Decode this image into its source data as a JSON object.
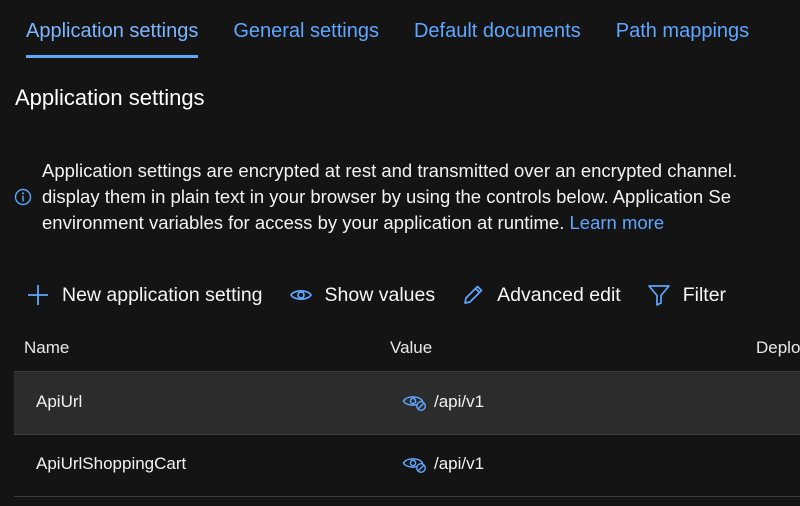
{
  "tabs": [
    {
      "label": "Application settings",
      "active": true
    },
    {
      "label": "General settings",
      "active": false
    },
    {
      "label": "Default documents",
      "active": false
    },
    {
      "label": "Path mappings",
      "active": false
    }
  ],
  "section": {
    "title": "Application settings"
  },
  "info": {
    "line1": "Application settings are encrypted at rest and transmitted over an encrypted channel.",
    "line2": "display them in plain text in your browser by using the controls below. Application Se",
    "line3": "environment variables for access by your application at runtime.",
    "link": "Learn more"
  },
  "toolbar": {
    "new_setting": "New application setting",
    "show_values": "Show values",
    "advanced_edit": "Advanced edit",
    "filter": "Filter"
  },
  "table": {
    "columns": [
      "Name",
      "Value",
      "Deplo"
    ],
    "rows": [
      {
        "name": "ApiUrl",
        "value": "/api/v1"
      },
      {
        "name": "ApiUrlShoppingCart",
        "value": "/api/v1"
      }
    ]
  },
  "colors": {
    "accent": "#5ea6ff",
    "background": "#141414",
    "row_highlight": "#2c2c2c"
  }
}
